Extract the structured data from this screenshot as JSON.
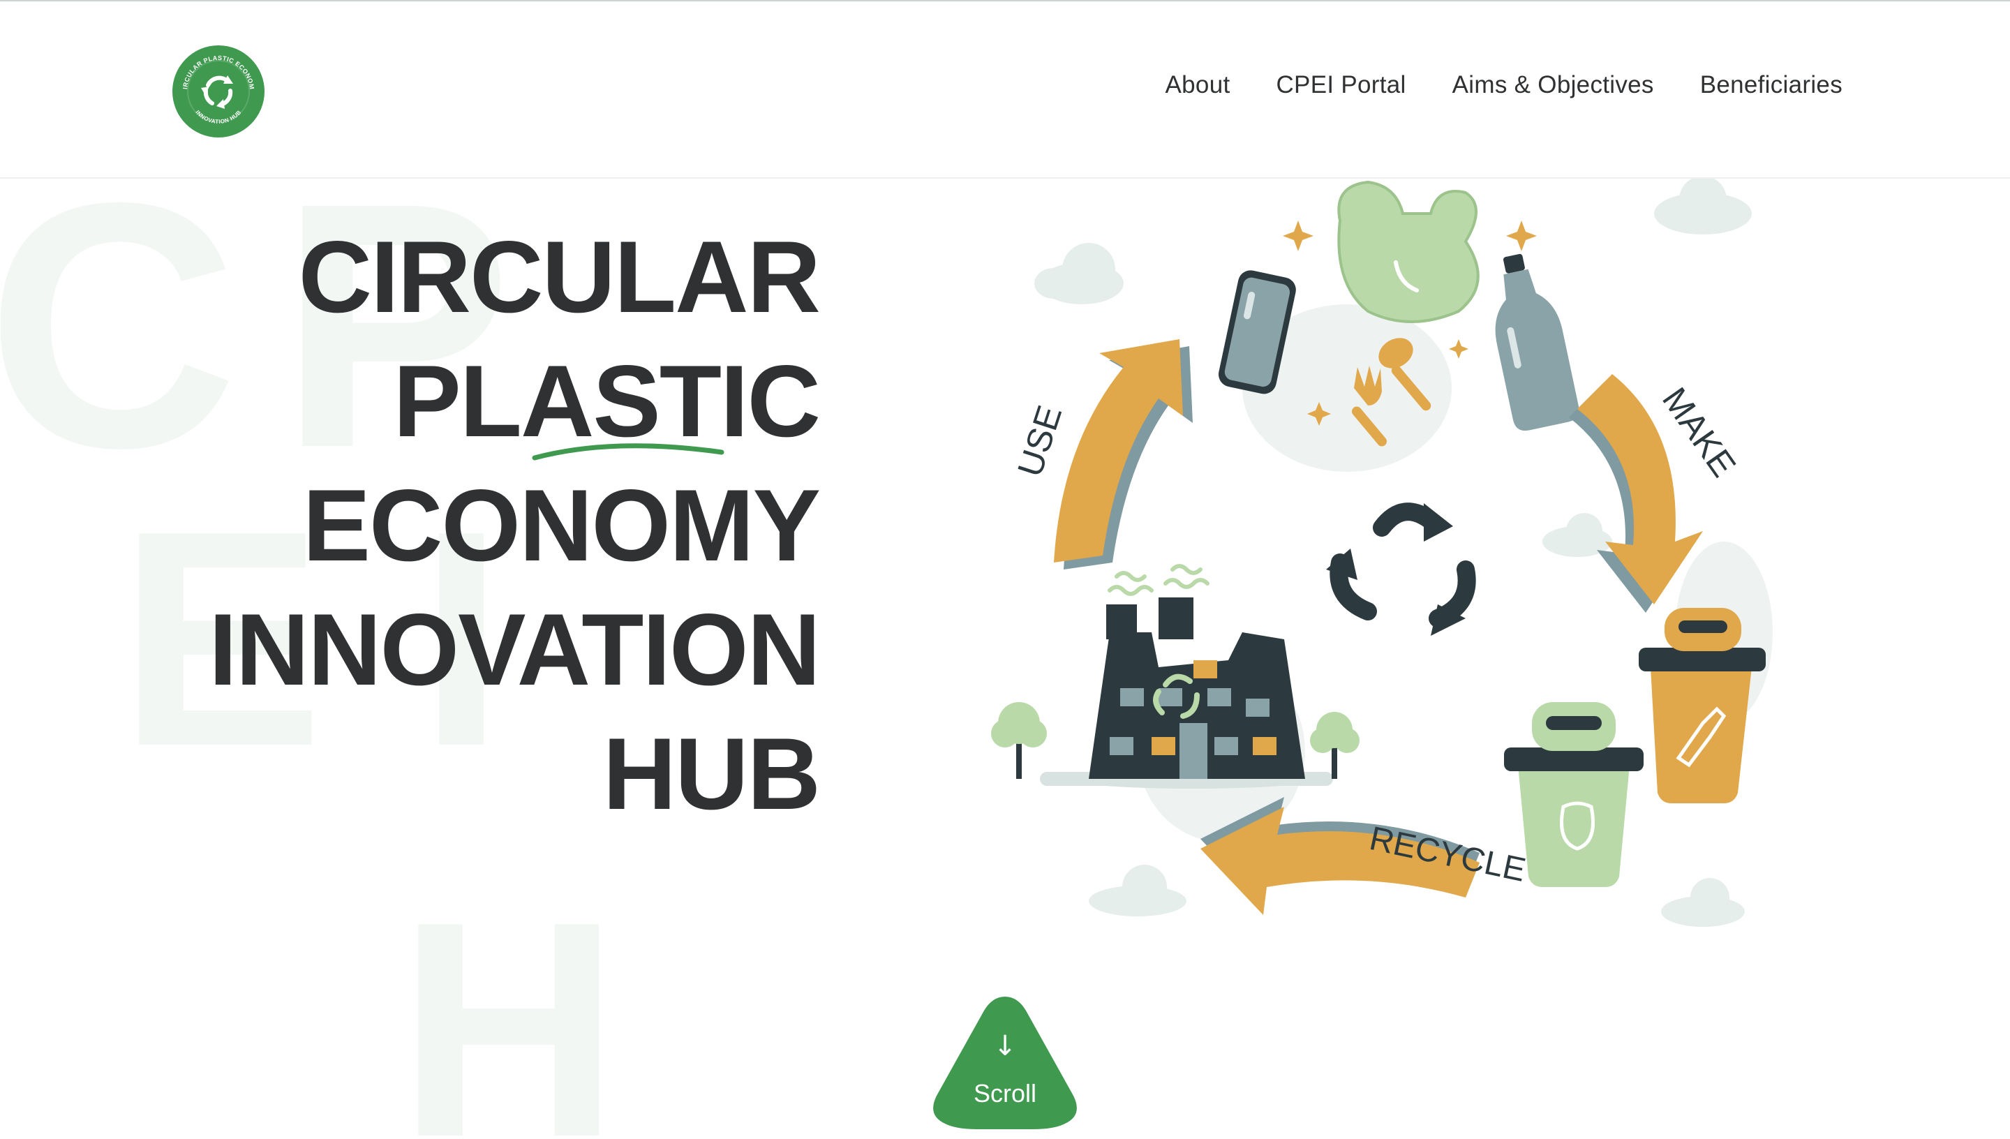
{
  "header": {
    "logo_text_top": "CIRCULAR PLASTIC ECONOMY",
    "logo_text_bottom": "INNOVATION HUB",
    "nav": [
      {
        "label": "About"
      },
      {
        "label": "CPEI Portal"
      },
      {
        "label": "Aims & Objectives"
      },
      {
        "label": "Beneficiaries"
      }
    ]
  },
  "hero": {
    "title_lines": [
      "CIRCULAR",
      "PLASTIC",
      "ECONOMY",
      "INNOVATION",
      "HUB"
    ],
    "background_letters": [
      "C",
      "P",
      "E",
      "I",
      "H"
    ]
  },
  "illustration": {
    "labels": {
      "use": "USE",
      "make": "MAKE",
      "recycle": "RECYCLE"
    }
  },
  "scroll": {
    "arrow": "↓",
    "label": "Scroll"
  },
  "colors": {
    "accent_green": "#3f9a4f",
    "text_dark": "#2f3133",
    "arrow_orange": "#e0a84a",
    "arrow_shadow": "#7f9aa0",
    "light_green": "#b9d9a8",
    "slate": "#2c3a3f"
  }
}
